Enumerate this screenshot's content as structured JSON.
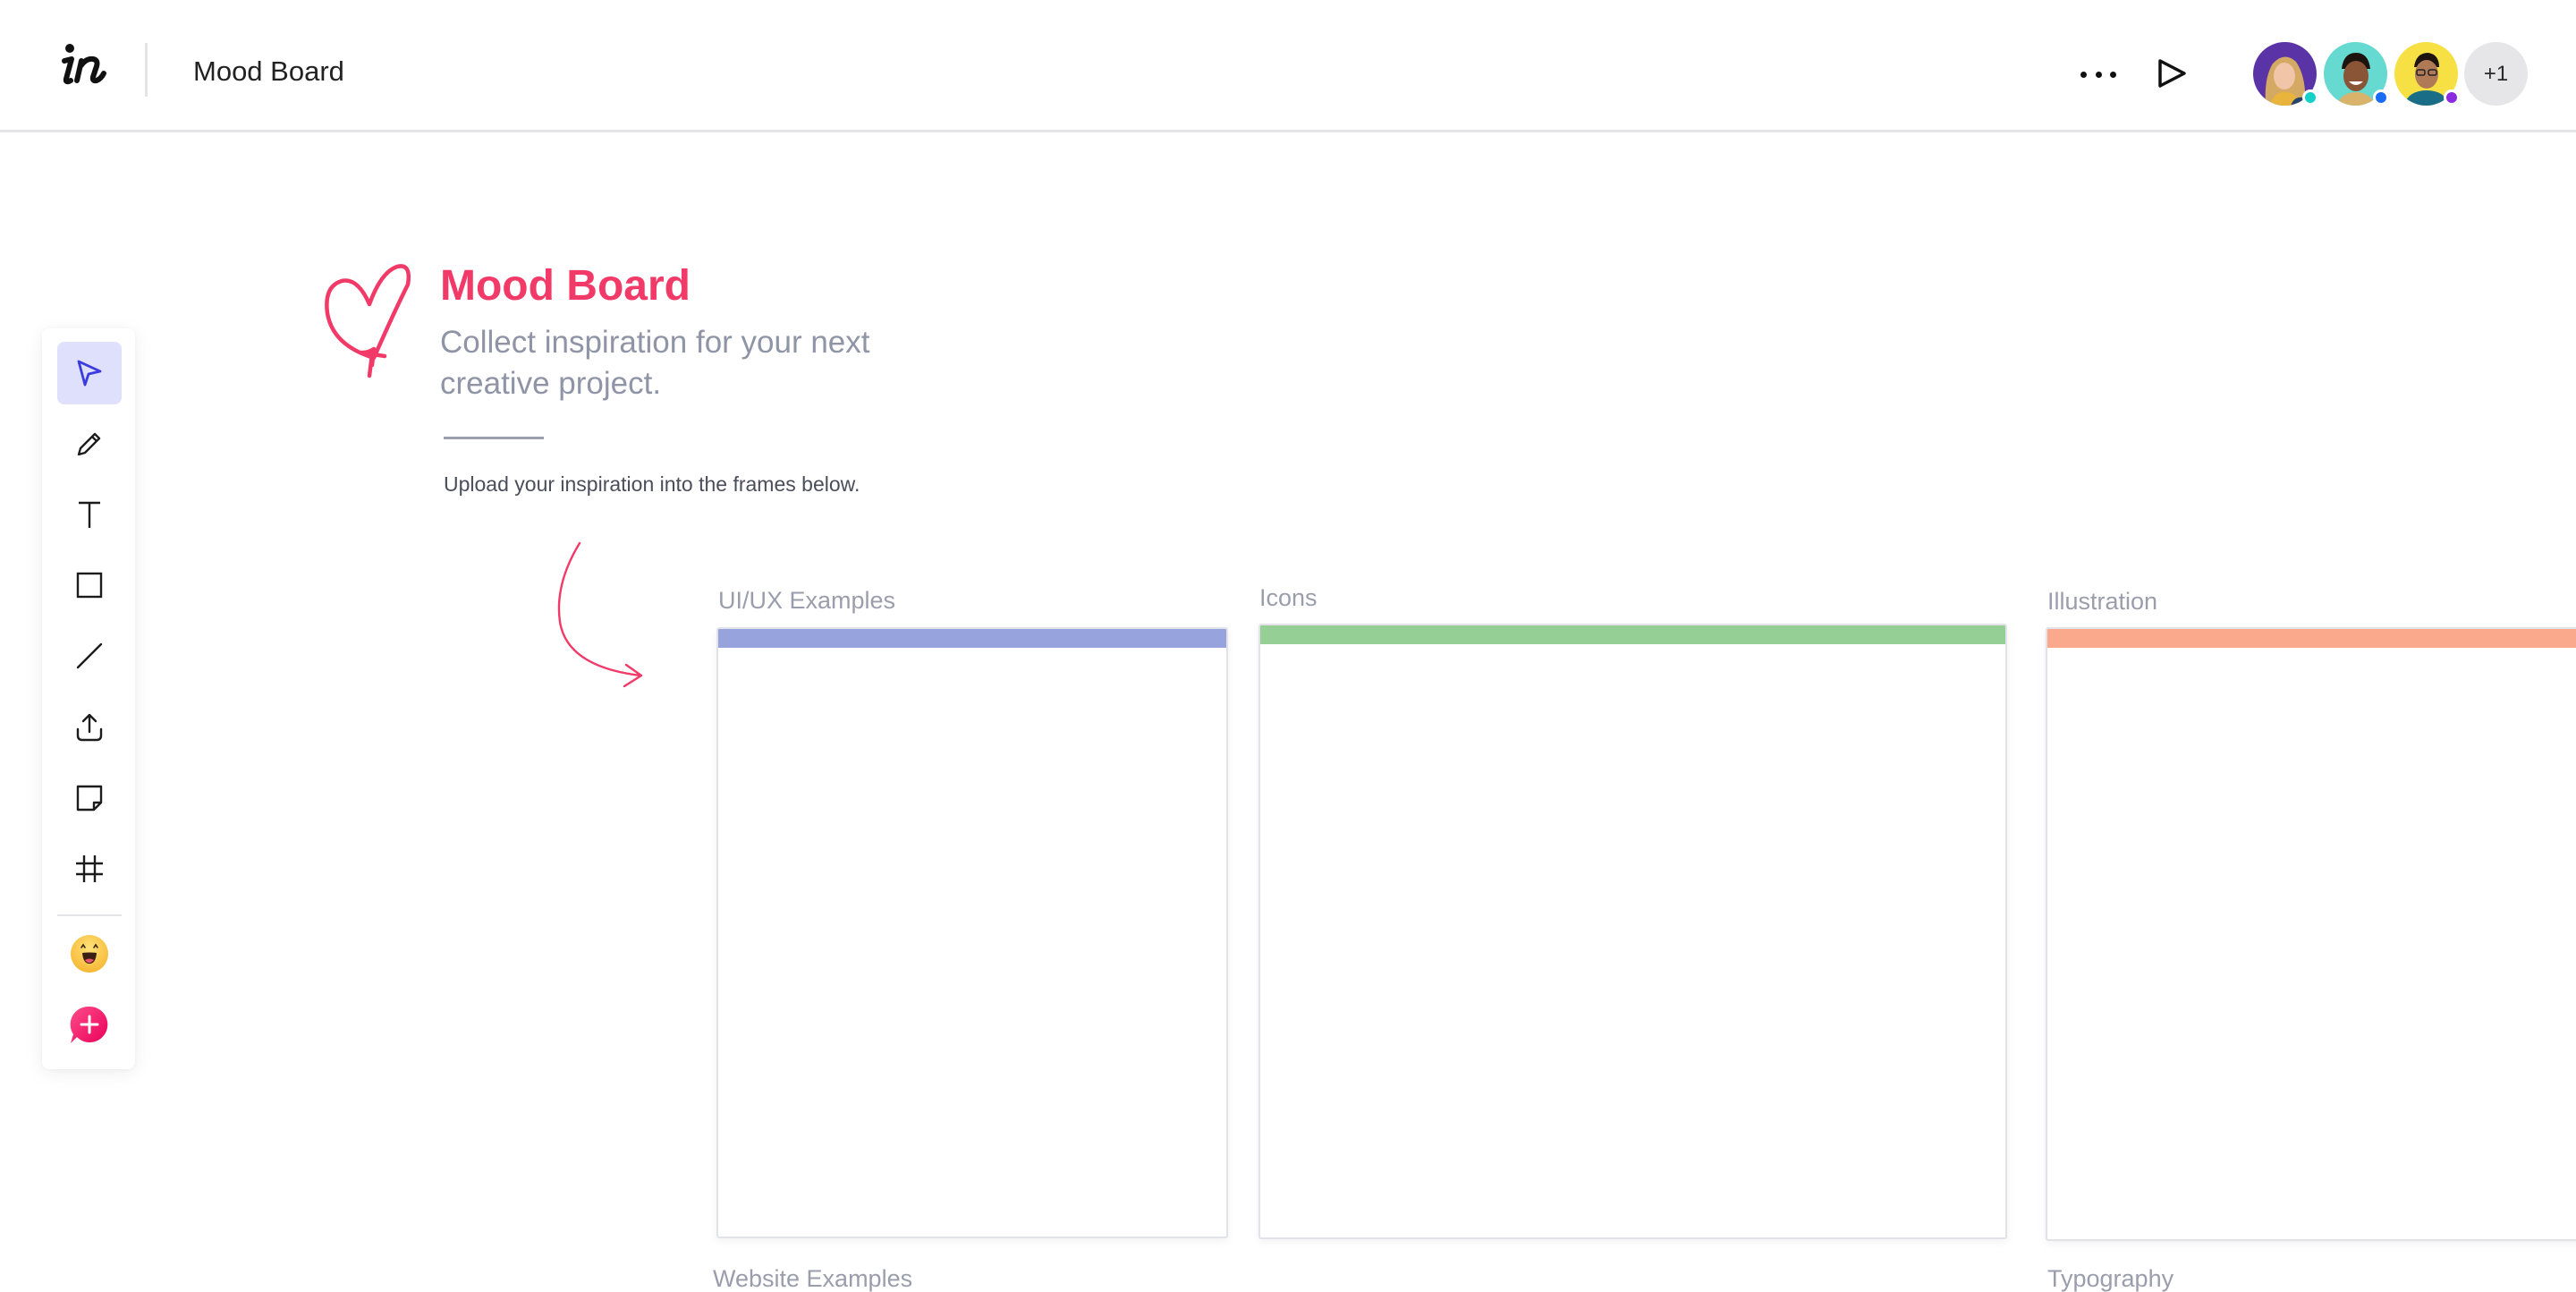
{
  "header": {
    "logo": "in",
    "title": "Mood Board",
    "more_icon": "more-horizontal-icon",
    "play_icon": "play-icon",
    "collaborators": [
      {
        "name": "collaborator-1",
        "bg": "#5a34a6",
        "status_color": "#14d0c8"
      },
      {
        "name": "collaborator-2",
        "bg": "#66d9d0",
        "status_color": "#1a6cf5"
      },
      {
        "name": "collaborator-3",
        "bg": "#f7e043",
        "status_color": "#8a2be2"
      }
    ],
    "more_collaborators": "+1"
  },
  "toolbar": {
    "tools": [
      {
        "id": "select",
        "icon": "cursor-arrow-icon",
        "active": true
      },
      {
        "id": "pencil",
        "icon": "pencil-icon",
        "active": false
      },
      {
        "id": "text",
        "icon": "text-icon",
        "active": false
      },
      {
        "id": "rectangle",
        "icon": "rectangle-icon",
        "active": false
      },
      {
        "id": "line",
        "icon": "line-icon",
        "active": false
      },
      {
        "id": "upload",
        "icon": "upload-icon",
        "active": false
      },
      {
        "id": "sticky-note",
        "icon": "sticky-note-icon",
        "active": false
      },
      {
        "id": "frame",
        "icon": "hash-grid-icon",
        "active": false
      },
      {
        "id": "emoji",
        "icon": "emoji-icon",
        "active": false
      },
      {
        "id": "comment",
        "icon": "add-comment-icon",
        "active": false
      }
    ],
    "accent": "#3b3be0",
    "active_bg": "#dfe0fc"
  },
  "canvas": {
    "title": "Mood Board",
    "subtitle": "Collect inspiration for your next creative project.",
    "instruction": "Upload your inspiration into the frames below.",
    "accent": "#f13a68",
    "frames": [
      {
        "label": "UI/UX Examples",
        "color": "#97a3dc"
      },
      {
        "label": "Icons",
        "color": "#95cf95"
      },
      {
        "label": "Illustration",
        "color": "#fba98d"
      }
    ],
    "lower_labels": [
      "Website Examples",
      "Typography"
    ]
  }
}
